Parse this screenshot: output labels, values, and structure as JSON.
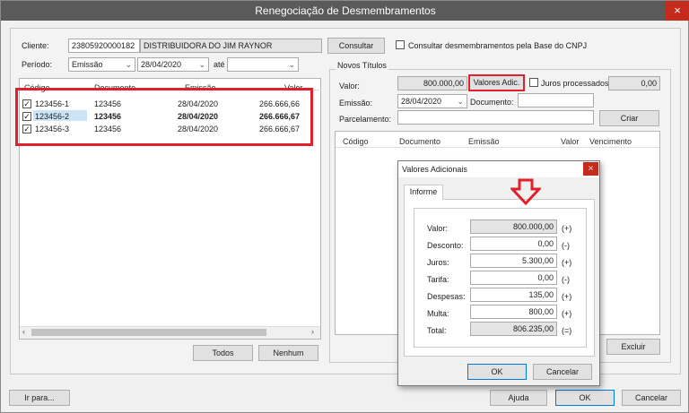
{
  "window": {
    "title": "Renegociação de Desmembramentos",
    "close_glyph": "×"
  },
  "filters": {
    "cliente_label": "Cliente:",
    "cliente_code": "23805920000182",
    "cliente_name": "DISTRIBUIDORA DO JIM RAYNOR",
    "consultar_label": "Consultar",
    "consultar_cnpj_label": "Consultar desmembramentos pela Base do CNPJ",
    "periodo_label": "Período:",
    "periodo_value": "Emissão",
    "date_from": "28/04/2020",
    "ate_label": "até",
    "date_to": ""
  },
  "left_grid": {
    "columns": [
      "Código",
      "Documento",
      "Emissão",
      "Valor"
    ],
    "rows": [
      {
        "codigo": "123456-1",
        "documento": "123456",
        "emissao": "28/04/2020",
        "valor": "266.666,66",
        "checked": true
      },
      {
        "codigo": "123456-2",
        "documento": "123456",
        "emissao": "28/04/2020",
        "valor": "266.666,67",
        "checked": true
      },
      {
        "codigo": "123456-3",
        "documento": "123456",
        "emissao": "28/04/2020",
        "valor": "266.666,67",
        "checked": true
      }
    ],
    "todos_label": "Todos",
    "nenhum_label": "Nenhum"
  },
  "novos_titulos": {
    "group_label": "Novos Títulos",
    "valor_label": "Valor:",
    "valor_value": "800.000,00",
    "valores_adic_label": "Valores Adic.",
    "juros_processados_label": "Juros processados",
    "juros_processados_value": "0,00",
    "emissao_label": "Emissão:",
    "emissao_value": "28/04/2020",
    "documento_label": "Documento:",
    "documento_value": "",
    "parcelamento_label": "Parcelamento:",
    "parcelamento_value": "",
    "criar_label": "Criar",
    "grid_columns": [
      "Código",
      "Documento",
      "Emissão",
      "Valor",
      "Vencimento"
    ],
    "excluir_label": "Excluir"
  },
  "dialog": {
    "title": "Valores Adicionais",
    "close_glyph": "×",
    "tab_label": "Informe",
    "fields": [
      {
        "label": "Valor:",
        "value": "800.000,00",
        "sign": "(+)",
        "readonly": true
      },
      {
        "label": "Desconto:",
        "value": "0,00",
        "sign": "(-)",
        "readonly": false
      },
      {
        "label": "Juros:",
        "value": "5.300,00",
        "sign": "(+)",
        "readonly": false
      },
      {
        "label": "Tarifa:",
        "value": "0,00",
        "sign": "(-)",
        "readonly": false
      },
      {
        "label": "Despesas:",
        "value": "135,00",
        "sign": "(+)",
        "readonly": false
      },
      {
        "label": "Multa:",
        "value": "800,00",
        "sign": "(+)",
        "readonly": false
      },
      {
        "label": "Total:",
        "value": "806.235,00",
        "sign": "(=)",
        "readonly": true
      }
    ],
    "ok_label": "OK",
    "cancelar_label": "Cancelar"
  },
  "footer": {
    "ir_para_label": "Ir para...",
    "ajuda_label": "Ajuda",
    "ok_label": "OK",
    "cancelar_label": "Cancelar"
  },
  "colors": {
    "highlight_red": "#e0202a",
    "titlebar": "#5a5a5a",
    "close_red": "#c42b1c"
  }
}
